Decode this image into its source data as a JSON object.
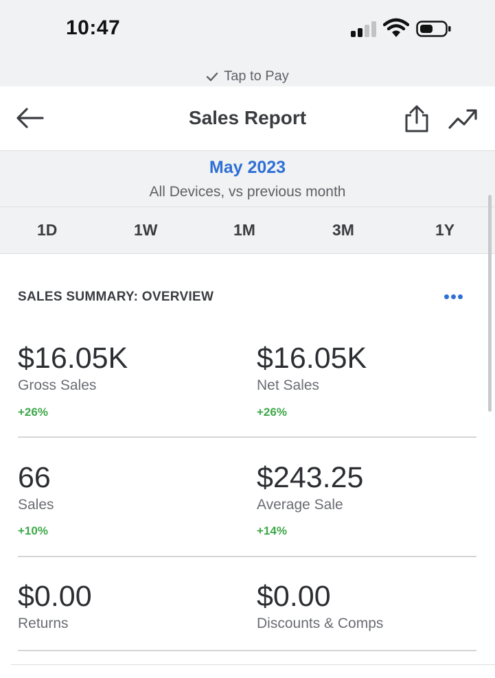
{
  "status_bar": {
    "time": "10:47",
    "tap_to_pay": "Tap to Pay"
  },
  "header": {
    "title": "Sales Report"
  },
  "date_panel": {
    "month": "May 2023",
    "subtitle": "All Devices, vs previous month",
    "ranges": [
      "1D",
      "1W",
      "1M",
      "3M",
      "1Y"
    ]
  },
  "summary": {
    "title": "SALES SUMMARY: OVERVIEW",
    "metrics": [
      {
        "value": "$16.05K",
        "label": "Gross Sales",
        "change": "+26%"
      },
      {
        "value": "$16.05K",
        "label": "Net Sales",
        "change": "+26%"
      },
      {
        "value": "66",
        "label": "Sales",
        "change": "+10%"
      },
      {
        "value": "$243.25",
        "label": "Average Sale",
        "change": "+14%"
      },
      {
        "value": "$0.00",
        "label": "Returns"
      },
      {
        "value": "$0.00",
        "label": "Discounts & Comps"
      }
    ]
  },
  "colors": {
    "accent": "#2e6fd6",
    "positive": "#3ea84a",
    "panel_bg": "#f1f2f3"
  },
  "icons": [
    "back-arrow-icon",
    "share-icon",
    "trend-chart-icon",
    "more-dots-icon",
    "check-icon",
    "wifi-icon",
    "battery-icon",
    "signal-icon"
  ]
}
